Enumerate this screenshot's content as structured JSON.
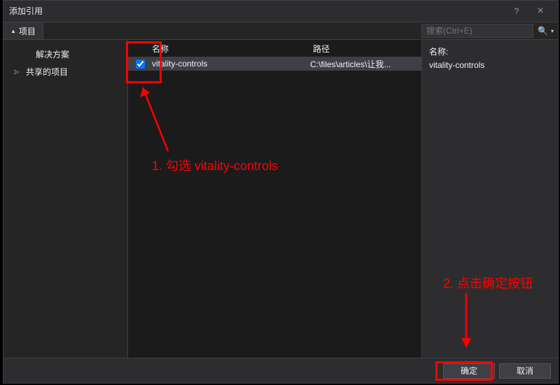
{
  "window": {
    "title": "添加引用",
    "help_hint": "?",
    "close_hint": "×"
  },
  "tabs": {
    "active_label": "项目"
  },
  "search": {
    "placeholder": "搜索(Ctrl+E)"
  },
  "sidebar": {
    "items": [
      {
        "label": "解决方案",
        "has_children": false
      },
      {
        "label": "共享的项目",
        "has_children": true
      }
    ]
  },
  "columns": {
    "name": "名称",
    "path": "路径"
  },
  "rows": [
    {
      "checked": true,
      "name": "vitality-controls",
      "path": "C:\\files\\articles\\让我..."
    }
  ],
  "detail": {
    "name_label": "名称:",
    "name_value": "vitality-controls"
  },
  "footer": {
    "ok": "确定",
    "cancel": "取消"
  },
  "annotations": {
    "step1": "1. 勾选 vitality-controls",
    "step2": "2. 点击确定按钮"
  }
}
